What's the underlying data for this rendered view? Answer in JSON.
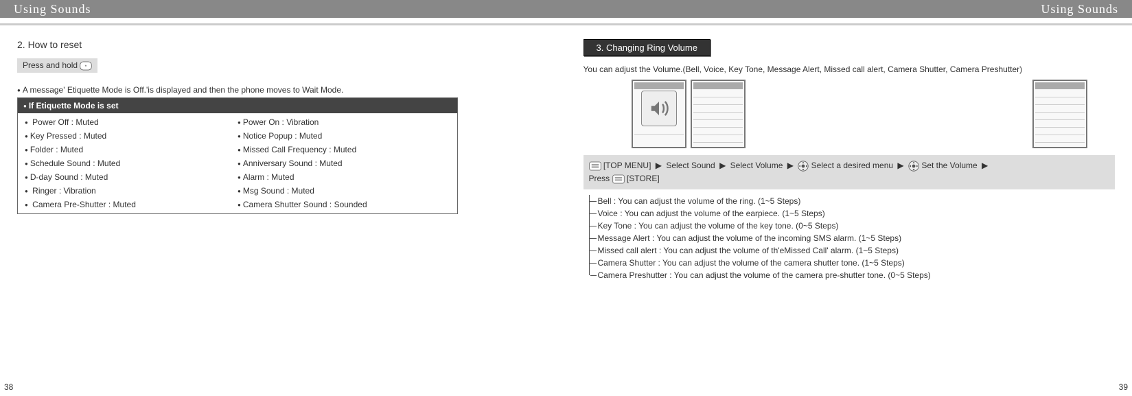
{
  "left": {
    "header": "Using Sounds",
    "section": "2. How to reset",
    "press_hold": "Press and hold",
    "msg": "A message'  Etiquette Mode is Off.'is displayed and then the phone moves to Wait Mode.",
    "box_header": "If Etiquette Mode is set",
    "rows": [
      [
        " Power Off : Muted",
        "Power On : Vibration"
      ],
      [
        "Key Pressed : Muted",
        "Notice Popup : Muted"
      ],
      [
        "Folder : Muted",
        "Missed Call Frequency : Muted"
      ],
      [
        "Schedule Sound : Muted",
        "Anniversary Sound : Muted"
      ],
      [
        "D-day Sound : Muted",
        "Alarm : Muted"
      ],
      [
        " Ringer : Vibration",
        "Msg Sound : Muted"
      ],
      [
        " Camera Pre-Shutter : Muted",
        "Camera Shutter Sound : Sounded"
      ]
    ],
    "page_num": "38"
  },
  "right": {
    "header": "Using Sounds",
    "tab": "3. Changing Ring Volume",
    "intro": "You can adjust the Volume.(Bell, Voice, Key Tone, Message Alert, Missed call alert, Camera Shutter, Camera Preshutter)",
    "nav": {
      "topmenu": "[TOP MENU]",
      "sel_sound": "Select Sound",
      "sel_volume": "Select Volume",
      "sel_menu": "Select a desired menu",
      "set_vol": "Set the Volume",
      "press": "Press",
      "store": "[STORE]"
    },
    "list": [
      "Bell : You can adjust the volume of the ring. (1~5 Steps)",
      "Voice : You can adjust the volume of the earpiece. (1~5 Steps)",
      "Key Tone : You can adjust the volume of the key tone. (0~5 Steps)",
      "Message Alert : You can adjust the volume of the incoming SMS alarm. (1~5 Steps)",
      "Missed call alert : You can adjust the volume of th'eMissed Call'  alarm. (1~5 Steps)",
      "Camera Shutter : You can adjust the volume of the camera shutter tone. (1~5 Steps)",
      "Camera Preshutter : You can adjust the volume of the camera pre-shutter tone. (0~5 Steps)"
    ],
    "page_num": "39"
  }
}
